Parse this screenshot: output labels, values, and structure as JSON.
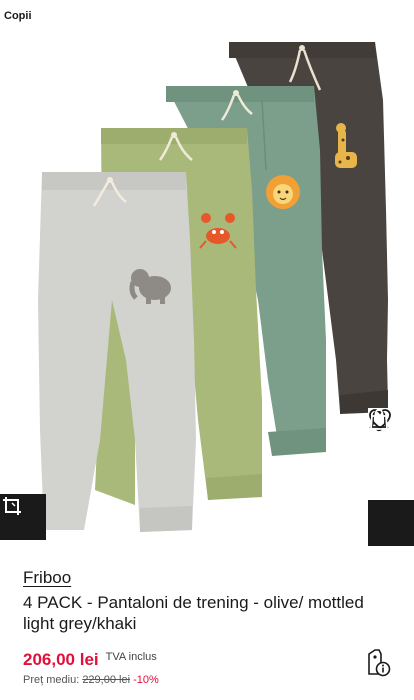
{
  "category": {
    "label": "Copii"
  },
  "product": {
    "brand": "Friboo",
    "title": "4 PACK  - Pantaloni de trening - olive/ mottled light grey/khaki",
    "price": "206,00 lei",
    "vat_label": "TVA inclus",
    "average_label": "Preț mediu:",
    "average_price": "229,00 lei",
    "discount": "-10%"
  },
  "icons": {
    "notify": "bell-icon",
    "wishlist": "heart-icon",
    "cart": "shopping-bag-icon",
    "view": "crop-view-icon",
    "price_info": "price-tag-info-icon"
  },
  "colors": {
    "price_red": "#e0103a",
    "dark_button": "#1a1a1a",
    "pants_charcoal": "#4a4440",
    "pants_sage": "#7b9f8a",
    "pants_olive": "#a9b97a",
    "pants_grey": "#d2d2cf"
  }
}
